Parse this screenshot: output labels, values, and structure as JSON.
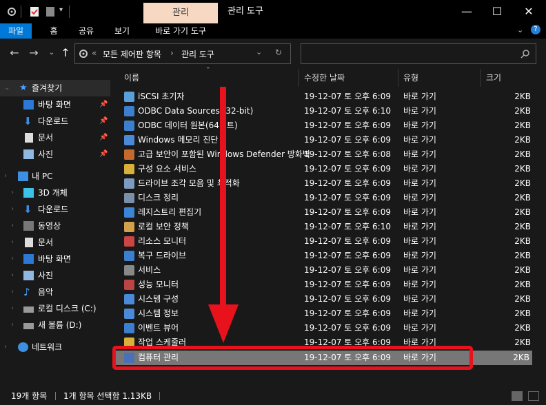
{
  "window": {
    "title": "관리 도구",
    "context_tab": "관리"
  },
  "ribbon": {
    "tabs": [
      "파일",
      "홈",
      "공유",
      "보기",
      "바로 가기 도구"
    ]
  },
  "address": {
    "overflow": "«",
    "crumbs": [
      "모든 제어판 항목",
      "관리 도구"
    ]
  },
  "search": {
    "placeholder": ""
  },
  "sidebar": {
    "quick_access": "즐겨찾기",
    "pinned": [
      "바탕 화면",
      "다운로드",
      "문서",
      "사진"
    ],
    "this_pc": "내 PC",
    "pc_items": [
      "3D 개체",
      "다운로드",
      "동영상",
      "문서",
      "바탕 화면",
      "사진",
      "음악",
      "로컬 디스크 (C:)",
      "새 볼륨 (D:)"
    ],
    "network": "네트워크"
  },
  "columns": {
    "name": "이름",
    "modified": "수정한 날짜",
    "type": "유형",
    "size": "크기"
  },
  "files": [
    {
      "name": "iSCSI 초기자",
      "date": "19-12-07 토 오후 6:09",
      "type": "바로 가기",
      "size": "2KB"
    },
    {
      "name": "ODBC Data Sources (32-bit)",
      "date": "19-12-07 토 오후 6:10",
      "type": "바로 가기",
      "size": "2KB"
    },
    {
      "name": "ODBC 데이터 원본(64비트)",
      "date": "19-12-07 토 오후 6:09",
      "type": "바로 가기",
      "size": "2KB"
    },
    {
      "name": "Windows 메모리 진단",
      "date": "19-12-07 토 오후 6:09",
      "type": "바로 가기",
      "size": "2KB"
    },
    {
      "name": "고급 보안이 포함된 Windows Defender 방화벽",
      "date": "19-12-07 토 오후 6:08",
      "type": "바로 가기",
      "size": "2KB"
    },
    {
      "name": "구성 요소 서비스",
      "date": "19-12-07 토 오후 6:09",
      "type": "바로 가기",
      "size": "2KB"
    },
    {
      "name": "드라이브 조각 모음 및 최적화",
      "date": "19-12-07 토 오후 6:09",
      "type": "바로 가기",
      "size": "2KB"
    },
    {
      "name": "디스크 정리",
      "date": "19-12-07 토 오후 6:09",
      "type": "바로 가기",
      "size": "2KB"
    },
    {
      "name": "레지스트리 편집기",
      "date": "19-12-07 토 오후 6:09",
      "type": "바로 가기",
      "size": "2KB"
    },
    {
      "name": "로컬 보안 정책",
      "date": "19-12-07 토 오후 6:10",
      "type": "바로 가기",
      "size": "2KB"
    },
    {
      "name": "리소스 모니터",
      "date": "19-12-07 토 오후 6:09",
      "type": "바로 가기",
      "size": "2KB"
    },
    {
      "name": "복구 드라이브",
      "date": "19-12-07 토 오후 6:09",
      "type": "바로 가기",
      "size": "2KB"
    },
    {
      "name": "서비스",
      "date": "19-12-07 토 오후 6:09",
      "type": "바로 가기",
      "size": "2KB"
    },
    {
      "name": "성능 모니터",
      "date": "19-12-07 토 오후 6:09",
      "type": "바로 가기",
      "size": "2KB"
    },
    {
      "name": "시스템 구성",
      "date": "19-12-07 토 오후 6:09",
      "type": "바로 가기",
      "size": "2KB"
    },
    {
      "name": "시스템 정보",
      "date": "19-12-07 토 오후 6:09",
      "type": "바로 가기",
      "size": "2KB"
    },
    {
      "name": "이벤트 뷰어",
      "date": "19-12-07 토 오후 6:09",
      "type": "바로 가기",
      "size": "2KB"
    },
    {
      "name": "작업 스케줄러",
      "date": "19-12-07 토 오후 6:09",
      "type": "바로 가기",
      "size": "2KB"
    },
    {
      "name": "컴퓨터 관리",
      "date": "19-12-07 토 오후 6:09",
      "type": "바로 가기",
      "size": "2KB"
    }
  ],
  "status": {
    "count": "19개 항목",
    "selected": "1개 항목 선택함 1.13KB"
  },
  "colors": {
    "accent": "#0078d7",
    "highlight": "#e8121c",
    "context_tab": "#f7d9c3"
  }
}
